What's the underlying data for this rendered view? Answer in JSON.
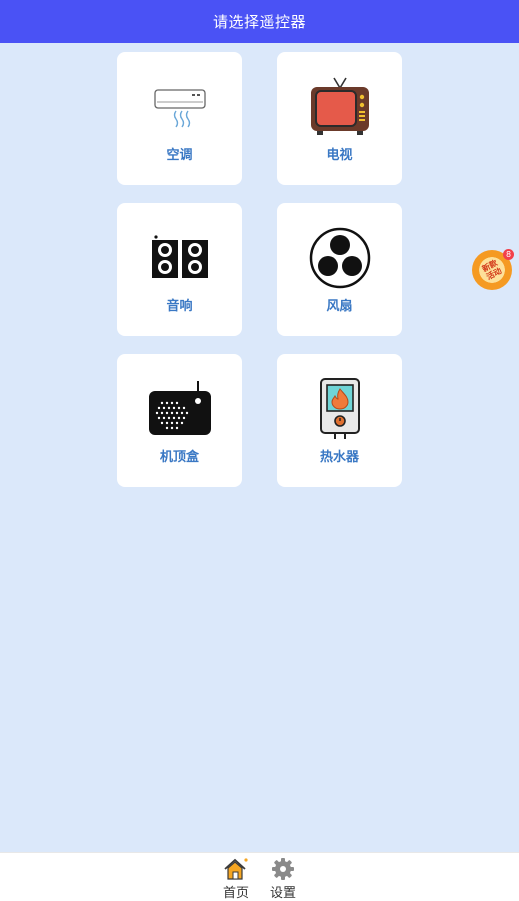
{
  "header": {
    "title": "请选择遥控器"
  },
  "devices": [
    {
      "label": "空调",
      "icon": "air-conditioner-icon"
    },
    {
      "label": "电视",
      "icon": "tv-icon"
    },
    {
      "label": "音响",
      "icon": "speaker-icon"
    },
    {
      "label": "风扇",
      "icon": "fan-icon"
    },
    {
      "label": "机顶盒",
      "icon": "set-top-box-icon"
    },
    {
      "label": "热水器",
      "icon": "water-heater-icon"
    }
  ],
  "float_badge": {
    "text": "新款活动",
    "count": "8"
  },
  "tabbar": {
    "items": [
      {
        "label": "首页",
        "icon": "home-icon",
        "active": true
      },
      {
        "label": "设置",
        "icon": "gear-icon",
        "active": false
      }
    ]
  },
  "colors": {
    "header_bg": "#4a52f5",
    "page_bg": "#dbe8fa",
    "label": "#3a78c4"
  }
}
